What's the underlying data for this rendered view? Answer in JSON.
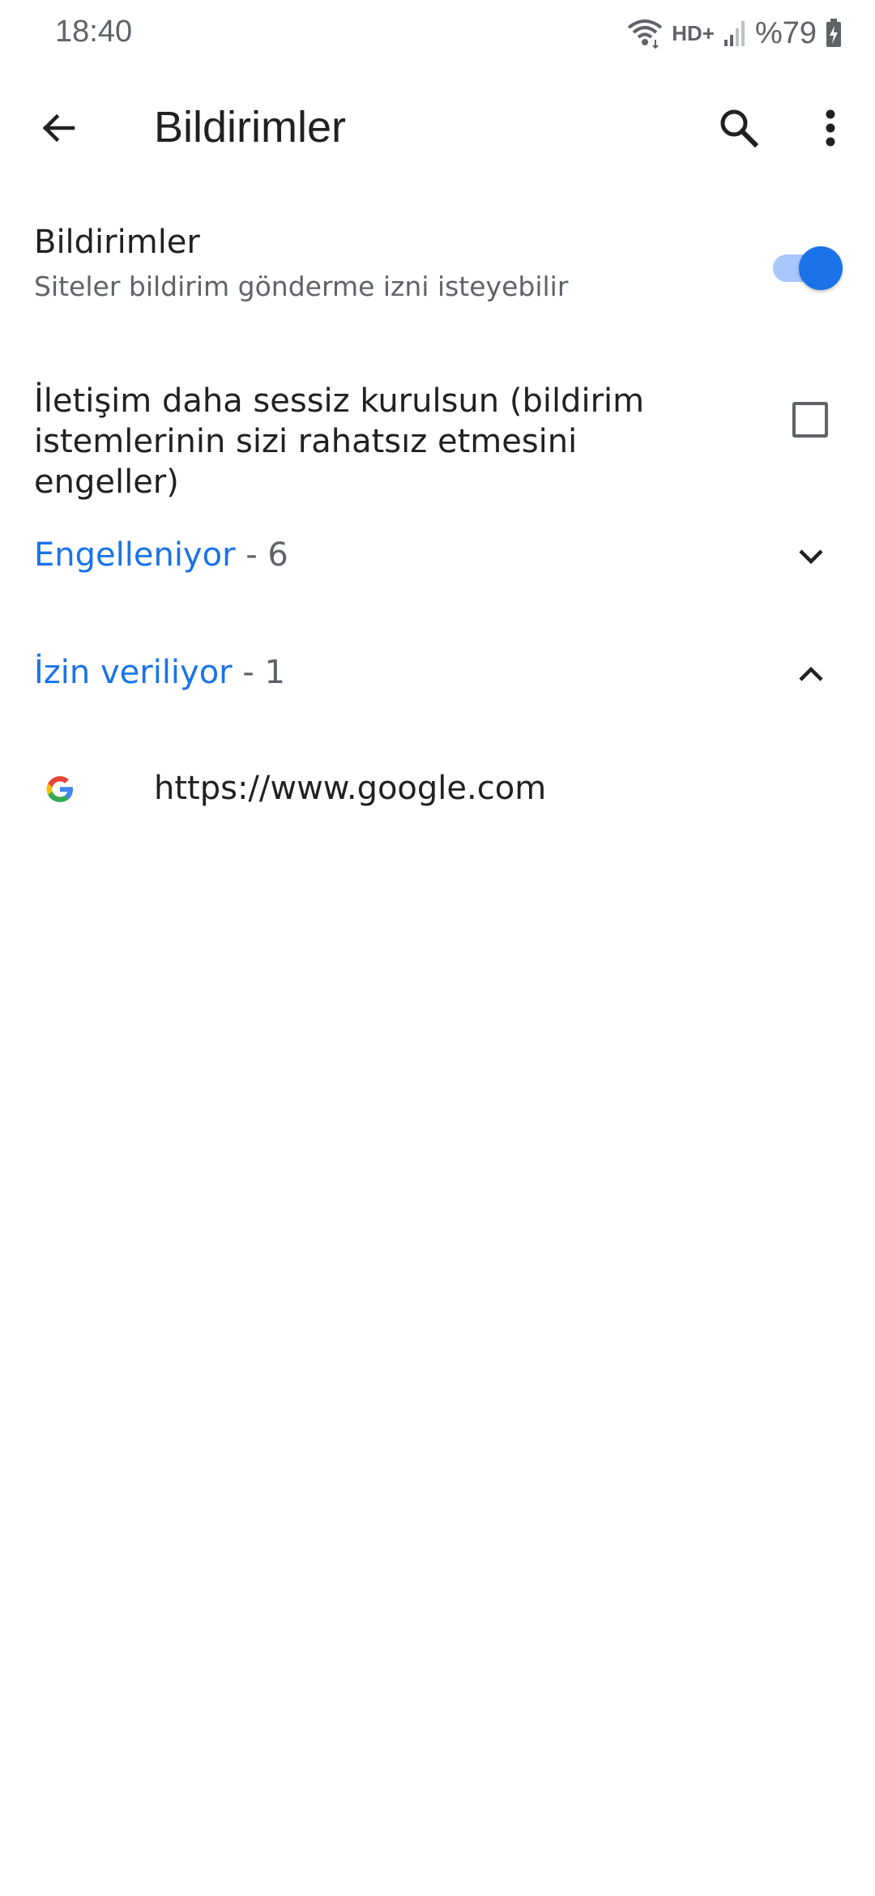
{
  "status_bar": {
    "time": "18:40",
    "network": "HD+",
    "battery": "%79"
  },
  "app_bar": {
    "title": "Bildirimler"
  },
  "notifications_setting": {
    "title": "Bildirimler",
    "subtitle": "Siteler bildirim gönderme izni isteyebilir",
    "enabled": true
  },
  "quieter_messaging": {
    "label": "İletişim daha sessiz kurulsun (bildirim istemlerinin sizi rahatsız etmesini engeller)",
    "checked": false
  },
  "sections": {
    "blocked": {
      "name": "Engelleniyor",
      "count": " - 6",
      "expanded": false
    },
    "allowed": {
      "name": "İzin veriliyor",
      "count": " - 1",
      "expanded": true
    }
  },
  "allowed_sites": [
    {
      "url": "https://www.google.com",
      "icon": "google-icon"
    }
  ],
  "colors": {
    "accent": "#1a73e8",
    "switch_track": "#a8c7fa",
    "text_primary": "#202124",
    "text_secondary": "#5f6368"
  }
}
